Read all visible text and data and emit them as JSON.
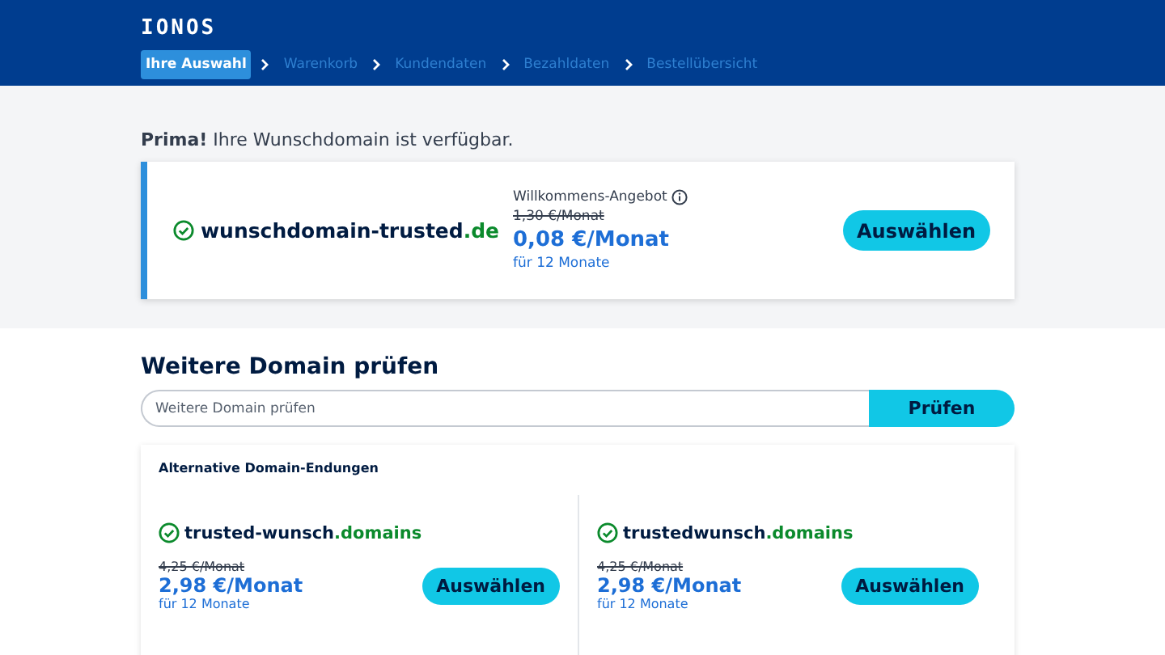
{
  "header": {
    "logo": "IONOS",
    "steps": [
      {
        "label": "Ihre Auswahl",
        "selected": true
      },
      {
        "label": "Warenkorb",
        "selected": false
      },
      {
        "label": "Kundendaten",
        "selected": false
      },
      {
        "label": "Bezahldaten",
        "selected": false
      },
      {
        "label": "Bestellübersicht",
        "selected": false
      }
    ]
  },
  "result": {
    "message": "**Prima!** Ihre Wunschdomain ist verfügbar.",
    "domain": {
      "name": "wunschdomain-trusted",
      "tld": ".de"
    },
    "offer_label": "Willkommens-Angebot",
    "old_price": "1,30 €/Monat",
    "price": "0,08 €/Monat",
    "term": "für 12 Monate",
    "button": "Auswählen"
  },
  "search": {
    "title": "Weitere Domain prüfen",
    "placeholder": "Weitere Domain prüfen",
    "button": "Prüfen"
  },
  "alternatives": {
    "title": "Alternative Domain-Endungen",
    "items": [
      {
        "name": "trusted-wunsch",
        "tld": ".domains",
        "old_price": "4,25 €/Monat",
        "price": "2,98 €/Monat",
        "term": "für 12 Monate",
        "button": "Auswählen"
      },
      {
        "name": "trustedwunsch",
        "tld": ".domains",
        "old_price": "4,25 €/Monat",
        "price": "2,98 €/Monat",
        "term": "für 12 Monate",
        "button": "Auswählen"
      }
    ]
  }
}
